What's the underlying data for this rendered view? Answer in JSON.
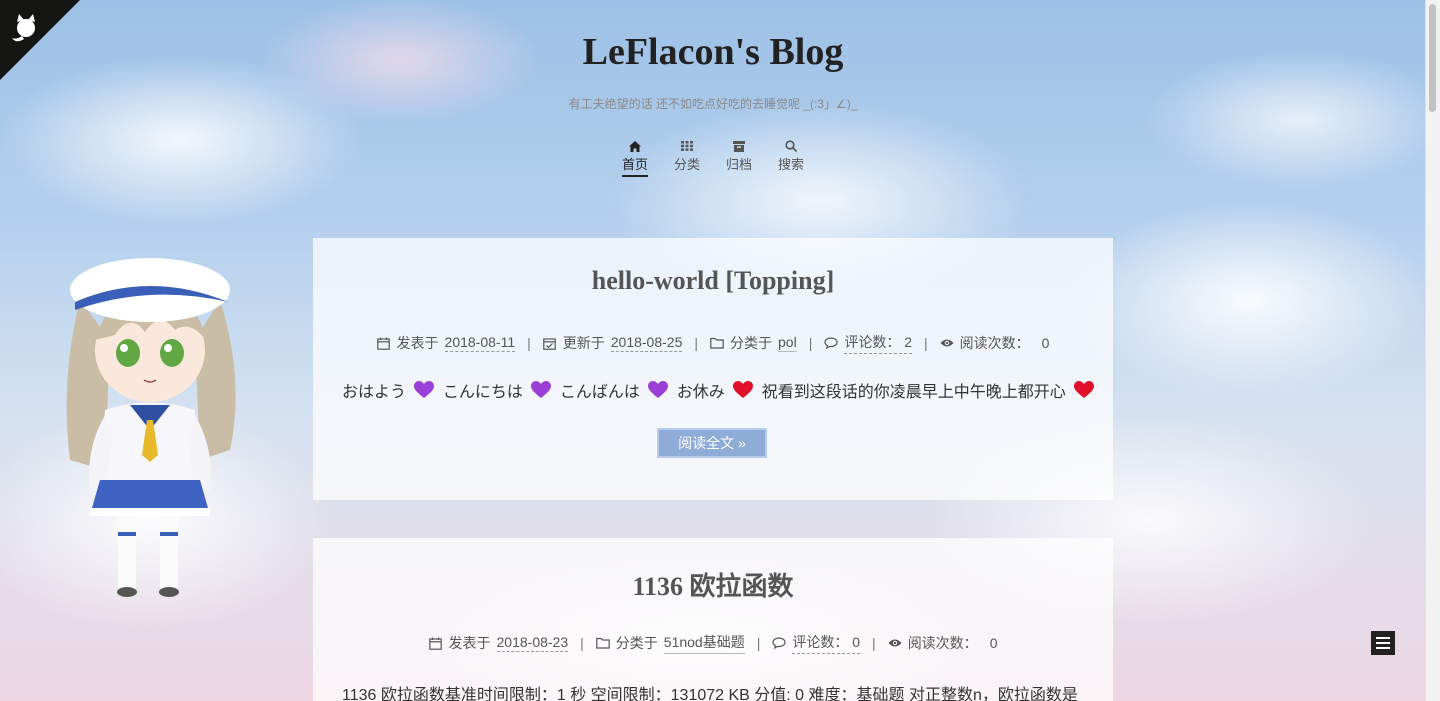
{
  "site": {
    "title": "LeFlacon's Blog",
    "subtitle": "有工夫绝望的话 还不如吃点好吃的去睡觉呢 _(:3」∠)_"
  },
  "menu": {
    "items": [
      {
        "label": "首页",
        "icon": "home-icon",
        "active": true
      },
      {
        "label": "分类",
        "icon": "grid-icon",
        "active": false
      },
      {
        "label": "归档",
        "icon": "archive-icon",
        "active": false
      },
      {
        "label": "搜索",
        "icon": "search-icon",
        "active": false
      }
    ]
  },
  "posts": [
    {
      "title": "hello-world [Topping]",
      "published_label": "发表于",
      "published_date": "2018-08-11",
      "updated_label": "更新于",
      "updated_date": "2018-08-25",
      "category_label": "分类于",
      "category": "pol",
      "comments_label": "评论数：",
      "comments_count": "2",
      "views_label": "阅读次数：",
      "views_count": "0",
      "excerpt": {
        "p1": "おはよう",
        "p2": "こんにちは",
        "p3": "こんばんは",
        "p4": "お休み",
        "p5": "祝看到这段话的你凌晨早上中午晚上都开心"
      },
      "read_more": "阅读全文",
      "read_more_icon": "»"
    },
    {
      "title": "1136 欧拉函数",
      "published_label": "发表于",
      "published_date": "2018-08-23",
      "category_label": "分类于",
      "category": "51nod基础题",
      "comments_label": "评论数：",
      "comments_count": "0",
      "views_label": "阅读次数：",
      "views_count": "0",
      "excerpt": "1136 欧拉函数基准时间限制：1 秒 空间限制：131072 KB 分值: 0 难度：基础题 对正整数n，欧拉函数是"
    }
  ],
  "colors": {
    "read_more_bg": "#8fabd8",
    "heart_purple": "#9b3fd6",
    "heart_red": "#e0102a"
  }
}
